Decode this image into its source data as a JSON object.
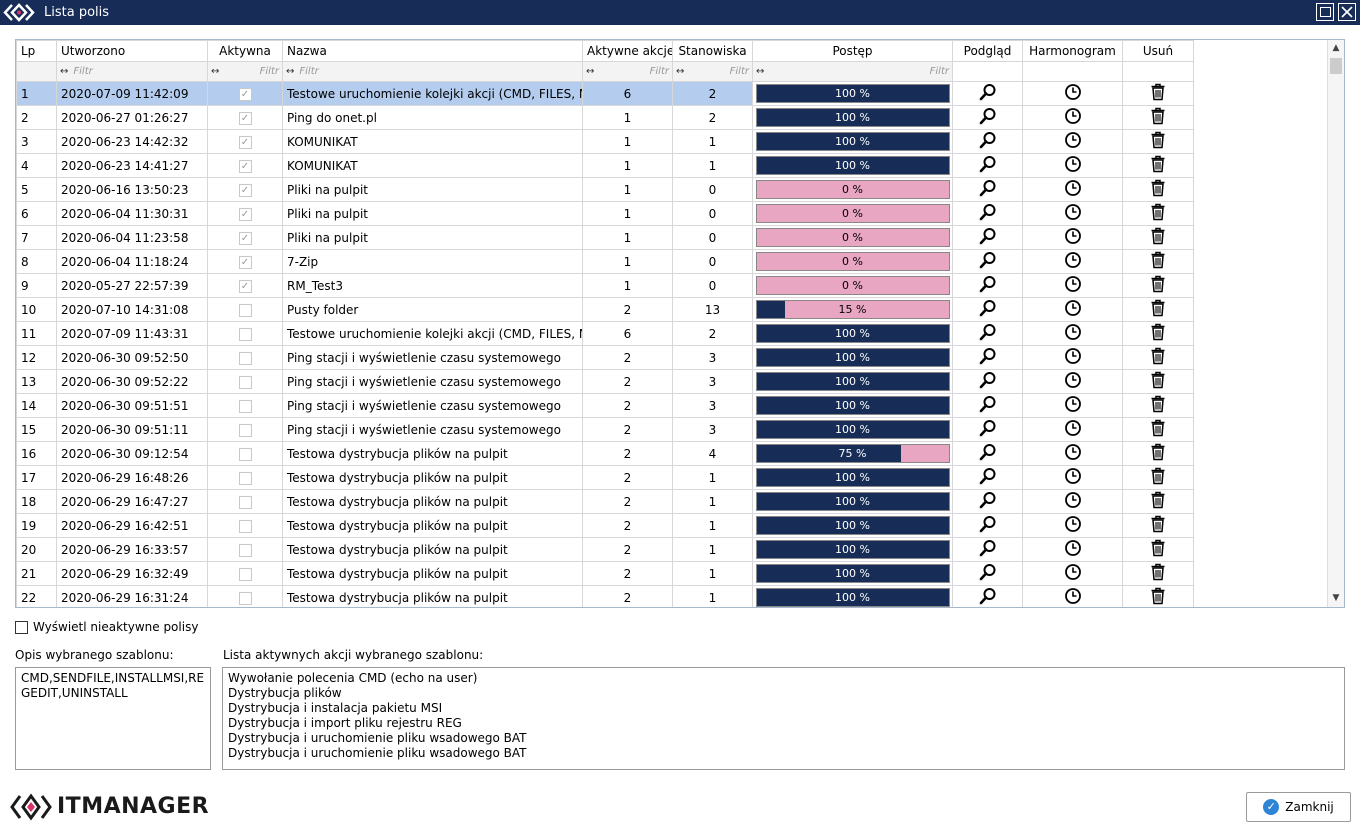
{
  "window": {
    "title": "Lista polis"
  },
  "columns": {
    "lp": "Lp",
    "created": "Utworzono",
    "active": "Aktywna",
    "name": "Nazwa",
    "actions": "Aktywne akcje",
    "stations": "Stanowiska",
    "progress": "Postęp",
    "preview": "Podgląd",
    "schedule": "Harmonogram",
    "delete": "Usuń"
  },
  "filter_placeholder": "Filtr",
  "colors": {
    "title_bar": "#172d57",
    "progress_fill": "#172d57",
    "progress_empty": "#e8a6c2",
    "selected_row": "#b4cdef"
  },
  "rows": [
    {
      "lp": "1",
      "created": "2020-07-09 11:42:09",
      "active": true,
      "name": "Testowe uruchomienie kolejki akcji (CMD, FILES, MSI,",
      "actions": "6",
      "stations": "2",
      "progress": 100,
      "progress_label": "100 %",
      "selected": true
    },
    {
      "lp": "2",
      "created": "2020-06-27 01:26:27",
      "active": true,
      "name": "Ping do onet.pl",
      "actions": "1",
      "stations": "2",
      "progress": 100,
      "progress_label": "100 %"
    },
    {
      "lp": "3",
      "created": "2020-06-23 14:42:32",
      "active": true,
      "name": "KOMUNIKAT",
      "actions": "1",
      "stations": "1",
      "progress": 100,
      "progress_label": "100 %"
    },
    {
      "lp": "4",
      "created": "2020-06-23 14:41:27",
      "active": true,
      "name": "KOMUNIKAT",
      "actions": "1",
      "stations": "1",
      "progress": 100,
      "progress_label": "100 %"
    },
    {
      "lp": "5",
      "created": "2020-06-16 13:50:23",
      "active": true,
      "name": "Pliki na pulpit",
      "actions": "1",
      "stations": "0",
      "progress": 0,
      "progress_label": "0 %"
    },
    {
      "lp": "6",
      "created": "2020-06-04 11:30:31",
      "active": true,
      "name": "Pliki na pulpit",
      "actions": "1",
      "stations": "0",
      "progress": 0,
      "progress_label": "0 %"
    },
    {
      "lp": "7",
      "created": "2020-06-04 11:23:58",
      "active": true,
      "name": "Pliki na pulpit",
      "actions": "1",
      "stations": "0",
      "progress": 0,
      "progress_label": "0 %"
    },
    {
      "lp": "8",
      "created": "2020-06-04 11:18:24",
      "active": true,
      "name": "7-Zip",
      "actions": "1",
      "stations": "0",
      "progress": 0,
      "progress_label": "0 %"
    },
    {
      "lp": "9",
      "created": "2020-05-27 22:57:39",
      "active": true,
      "name": "RM_Test3",
      "actions": "1",
      "stations": "0",
      "progress": 0,
      "progress_label": "0 %"
    },
    {
      "lp": "10",
      "created": "2020-07-10 14:31:08",
      "active": false,
      "name": "Pusty folder",
      "actions": "2",
      "stations": "13",
      "progress": 15,
      "progress_label": "15 %"
    },
    {
      "lp": "11",
      "created": "2020-07-09 11:43:31",
      "active": false,
      "name": "Testowe uruchomienie kolejki akcji (CMD, FILES, MSI,",
      "actions": "6",
      "stations": "2",
      "progress": 100,
      "progress_label": "100 %"
    },
    {
      "lp": "12",
      "created": "2020-06-30 09:52:50",
      "active": false,
      "name": "Ping stacji i wyświetlenie czasu systemowego",
      "actions": "2",
      "stations": "3",
      "progress": 100,
      "progress_label": "100 %"
    },
    {
      "lp": "13",
      "created": "2020-06-30 09:52:22",
      "active": false,
      "name": "Ping stacji i wyświetlenie czasu systemowego",
      "actions": "2",
      "stations": "3",
      "progress": 100,
      "progress_label": "100 %"
    },
    {
      "lp": "14",
      "created": "2020-06-30 09:51:51",
      "active": false,
      "name": "Ping stacji i wyświetlenie czasu systemowego",
      "actions": "2",
      "stations": "3",
      "progress": 100,
      "progress_label": "100 %"
    },
    {
      "lp": "15",
      "created": "2020-06-30 09:51:11",
      "active": false,
      "name": "Ping stacji i wyświetlenie czasu systemowego",
      "actions": "2",
      "stations": "3",
      "progress": 100,
      "progress_label": "100 %"
    },
    {
      "lp": "16",
      "created": "2020-06-30 09:12:54",
      "active": false,
      "name": "Testowa dystrybucja plików na pulpit",
      "actions": "2",
      "stations": "4",
      "progress": 75,
      "progress_label": "75 %"
    },
    {
      "lp": "17",
      "created": "2020-06-29 16:48:26",
      "active": false,
      "name": "Testowa dystrybucja plików na pulpit",
      "actions": "2",
      "stations": "1",
      "progress": 100,
      "progress_label": "100 %"
    },
    {
      "lp": "18",
      "created": "2020-06-29 16:47:27",
      "active": false,
      "name": "Testowa dystrybucja plików na pulpit",
      "actions": "2",
      "stations": "1",
      "progress": 100,
      "progress_label": "100 %"
    },
    {
      "lp": "19",
      "created": "2020-06-29 16:42:51",
      "active": false,
      "name": "Testowa dystrybucja plików na pulpit",
      "actions": "2",
      "stations": "1",
      "progress": 100,
      "progress_label": "100 %"
    },
    {
      "lp": "20",
      "created": "2020-06-29 16:33:57",
      "active": false,
      "name": "Testowa dystrybucja plików na pulpit",
      "actions": "2",
      "stations": "1",
      "progress": 100,
      "progress_label": "100 %"
    },
    {
      "lp": "21",
      "created": "2020-06-29 16:32:49",
      "active": false,
      "name": "Testowa dystrybucja plików na pulpit",
      "actions": "2",
      "stations": "1",
      "progress": 100,
      "progress_label": "100 %"
    },
    {
      "lp": "22",
      "created": "2020-06-29 16:31:24",
      "active": false,
      "name": "Testowa dystrybucja plików na pulpit",
      "actions": "2",
      "stations": "1",
      "progress": 100,
      "progress_label": "100 %"
    }
  ],
  "show_inactive": {
    "label": "Wyświetl nieaktywne polisy",
    "checked": false
  },
  "description": {
    "label": "Opis wybranego szablonu:",
    "text": "CMD,SENDFILE,INSTALLMSI,REGEDIT,UNINSTALL"
  },
  "actions_list": {
    "label": "Lista aktywnych akcji wybranego szablonu:",
    "items": [
      "Wywołanie polecenia CMD (echo na user)",
      "Dystrybucja plików",
      "Dystrybucja i instalacja pakietu MSI",
      "Dystrybucja i import pliku rejestru REG",
      "Dystrybucja i uruchomienie pliku wsadowego BAT",
      "Dystrybucja i uruchomienie pliku wsadowego BAT"
    ]
  },
  "logo": {
    "text": "ITMANAGER"
  },
  "close_button": {
    "label": "Zamknij"
  },
  "icons": {
    "app": "itmanager-logo-icon",
    "maximize": "maximize-icon",
    "close": "close-icon",
    "preview": "magnifier-icon",
    "schedule": "clock-icon",
    "delete": "trash-icon",
    "resize": "resize-arrows-icon"
  }
}
